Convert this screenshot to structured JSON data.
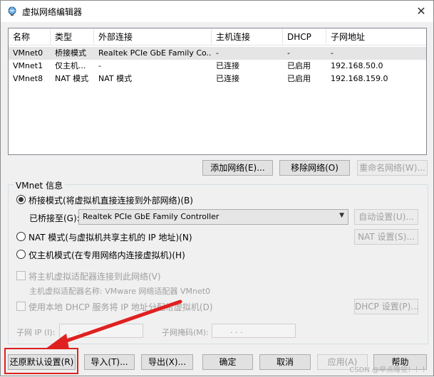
{
  "window": {
    "title": "虚拟网络编辑器",
    "close_glyph": "✕"
  },
  "table": {
    "columns": [
      "名称",
      "类型",
      "外部连接",
      "主机连接",
      "DHCP",
      "子网地址"
    ],
    "rows": [
      [
        "VMnet0",
        "桥接模式",
        "Realtek PCIe GbE Family Co...",
        "-",
        "-",
        "-"
      ],
      [
        "VMnet1",
        "仅主机...",
        "-",
        "已连接",
        "已启用",
        "192.168.50.0"
      ],
      [
        "VMnet8",
        "NAT 模式",
        "NAT 模式",
        "已连接",
        "已启用",
        "192.168.159.0"
      ]
    ],
    "selected_row": 0
  },
  "network_buttons": {
    "add": "添加网络(E)...",
    "remove": "移除网络(O)",
    "rename": "重命名网络(W)..."
  },
  "vmnet_info": {
    "group_label": "VMnet 信息",
    "bridge_option": "桥接模式(将虚拟机直接连接到外部网络)(B)",
    "bridged_to_label": "已桥接至(G):",
    "bridged_to_value": "Realtek PCIe GbE Family Controller",
    "auto_settings": "自动设置(U)...",
    "nat_option": "NAT 模式(与虚拟机共享主机的 IP 地址)(N)",
    "nat_settings": "NAT 设置(S)...",
    "hostonly_option": "仅主机模式(在专用网络内连接虚拟机)(H)",
    "connect_adapter": "将主机虚拟适配器连接到此网络(V)",
    "adapter_name": "主机虚拟适配器名称: VMware 网络适配器 VMnet0",
    "use_dhcp": "使用本地 DHCP 服务将 IP 地址分配给虚拟机(D)",
    "dhcp_settings": "DHCP 设置(P)...",
    "subnet_ip_label": "子网 IP (I):",
    "subnet_mask_label": "子网掩码(M):",
    "ip_dots": ".        .        .",
    "selected_mode": "bridge"
  },
  "footer": {
    "restore": "还原默认设置(R)",
    "import": "导入(T)...",
    "export": "导出(X)...",
    "ok": "确定",
    "cancel": "取消",
    "apply": "应用(A)",
    "help": "帮助"
  },
  "watermark": "CSDN @早点睡觉！！！",
  "colors": {
    "highlight": "#e02020",
    "selected_row": "#e5e5e5"
  }
}
